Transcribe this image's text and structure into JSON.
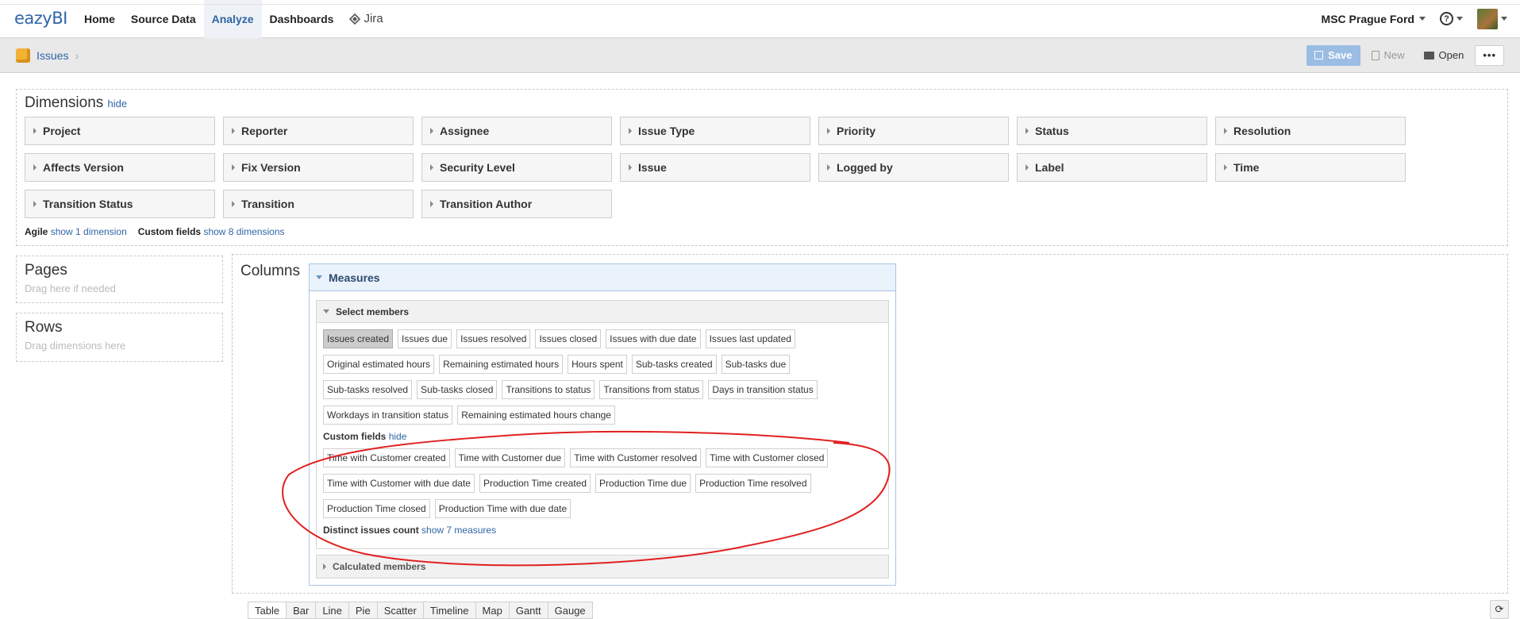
{
  "app": {
    "logo_text": "eazyBI",
    "nav": [
      "Home",
      "Source Data",
      "Analyze",
      "Dashboards"
    ],
    "active_nav": "Analyze",
    "jira_label": "Jira",
    "account": "MSC Prague Ford",
    "help_symbol": "?"
  },
  "breadcrumb": {
    "cube": "Issues",
    "separator": "›"
  },
  "toolbar": {
    "save": "Save",
    "new": "New",
    "open": "Open",
    "more": "•••"
  },
  "dimensions": {
    "title": "Dimensions",
    "hide": "hide",
    "items": [
      "Project",
      "Reporter",
      "Assignee",
      "Issue Type",
      "Priority",
      "Status",
      "Resolution",
      "Affects Version",
      "Fix Version",
      "Security Level",
      "Issue",
      "Logged by",
      "Label",
      "Time",
      "Transition Status",
      "Transition",
      "Transition Author"
    ],
    "groups": [
      {
        "label": "Agile",
        "link": "show 1 dimension"
      },
      {
        "label": "Custom fields",
        "link": "show 8 dimensions"
      }
    ]
  },
  "pages": {
    "title": "Pages",
    "hint": "Drag here if needed"
  },
  "rows": {
    "title": "Rows",
    "hint": "Drag dimensions here"
  },
  "columns": {
    "title": "Columns",
    "measures_label": "Measures",
    "select_members": "Select members",
    "standard": [
      "Issues created",
      "Issues due",
      "Issues resolved",
      "Issues closed",
      "Issues with due date",
      "Issues last updated",
      "Original estimated hours",
      "Remaining estimated hours",
      "Hours spent",
      "Sub-tasks created",
      "Sub-tasks due",
      "Sub-tasks resolved",
      "Sub-tasks closed",
      "Transitions to status",
      "Transitions from status",
      "Days in transition status",
      "Workdays in transition status",
      "Remaining estimated hours change"
    ],
    "selected": "Issues created",
    "custom_fields_label": "Custom fields",
    "custom_fields_hide": "hide",
    "custom": [
      "Time with Customer created",
      "Time with Customer due",
      "Time with Customer resolved",
      "Time with Customer closed",
      "Time with Customer with due date",
      "Production Time created",
      "Production Time due",
      "Production Time resolved",
      "Production Time closed",
      "Production Time with due date"
    ],
    "distinct_label": "Distinct issues count",
    "distinct_link": "show 7 measures",
    "calculated_members": "Calculated members"
  },
  "view_tabs": [
    "Table",
    "Bar",
    "Line",
    "Pie",
    "Scatter",
    "Timeline",
    "Map",
    "Gantt",
    "Gauge"
  ],
  "colors": {
    "accent": "#2f66a6",
    "annotation": "#e02020",
    "save_button": "#9bbce3"
  }
}
